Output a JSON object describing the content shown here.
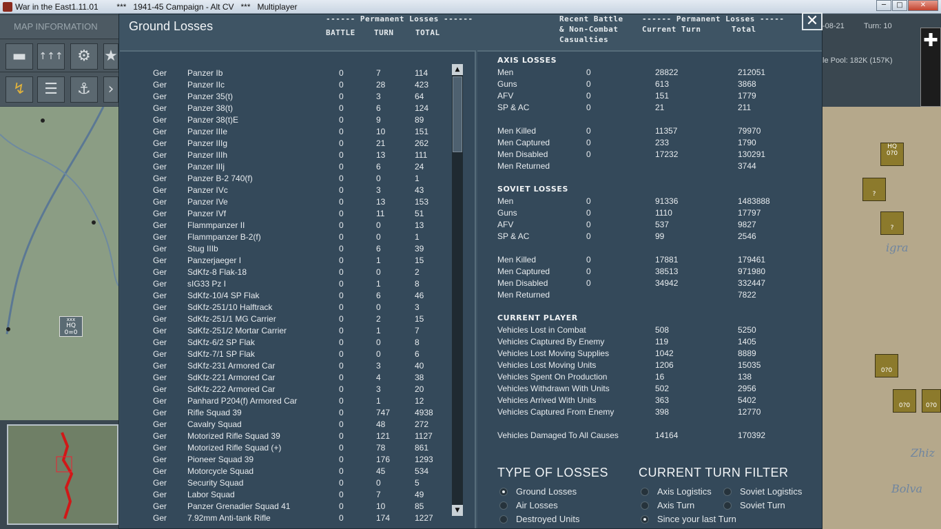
{
  "window": {
    "title": "War in the East1.11.01        ***   1941-45 Campaign - Alt CV   ***   Multiplayer",
    "minimize": "─",
    "maximize": "□",
    "close": "✕"
  },
  "sidebar": {
    "map_info_label": "MAP INFORMATION",
    "mode_keys": [
      "F1",
      "F2",
      "F3"
    ],
    "hq_label": "HQ",
    "hq_value": "0=0",
    "hq_size": "xxx"
  },
  "right_strip": {
    "date_fragment": "-08-21",
    "turn_label": "Turn: 10",
    "pool_label": "le Pool: 182K (157K)",
    "counter_label_hq": "HQ",
    "counter_value": "0?0",
    "counter_question": "?",
    "map_label_1": "igra",
    "map_label_2": "Bolva",
    "map_label_3": "Zhiz"
  },
  "dialog": {
    "title": "Ground Losses",
    "close_icon": "close-icon",
    "close_glyph": "✕",
    "left_header_group": "------ Permanent Losses ------",
    "left_col_battle": "BATTLE",
    "left_col_turn": "TURN",
    "left_col_total": "TOTAL",
    "right_header_recent_1": "Recent Battle",
    "right_header_recent_2": "& Non-Combat",
    "right_header_recent_3": "Casualties",
    "right_header_group": "------ Permanent Losses -----",
    "right_col_current": "Current Turn",
    "right_col_total": "Total"
  },
  "unit_rows": [
    {
      "nation": "Ger",
      "unit": "Panzer Ib",
      "battle": "0",
      "turn": "7",
      "total": "114"
    },
    {
      "nation": "Ger",
      "unit": "Panzer IIc",
      "battle": "0",
      "turn": "28",
      "total": "423"
    },
    {
      "nation": "Ger",
      "unit": "Panzer 35(t)",
      "battle": "0",
      "turn": "3",
      "total": "64"
    },
    {
      "nation": "Ger",
      "unit": "Panzer 38(t)",
      "battle": "0",
      "turn": "6",
      "total": "124"
    },
    {
      "nation": "Ger",
      "unit": "Panzer 38(t)E",
      "battle": "0",
      "turn": "9",
      "total": "89"
    },
    {
      "nation": "Ger",
      "unit": "Panzer IIIe",
      "battle": "0",
      "turn": "10",
      "total": "151"
    },
    {
      "nation": "Ger",
      "unit": "Panzer IIIg",
      "battle": "0",
      "turn": "21",
      "total": "262"
    },
    {
      "nation": "Ger",
      "unit": "Panzer IIIh",
      "battle": "0",
      "turn": "13",
      "total": "111"
    },
    {
      "nation": "Ger",
      "unit": "Panzer IIIj",
      "battle": "0",
      "turn": "6",
      "total": "24"
    },
    {
      "nation": "Ger",
      "unit": "Panzer B-2 740(f)",
      "battle": "0",
      "turn": "0",
      "total": "1"
    },
    {
      "nation": "Ger",
      "unit": "Panzer IVc",
      "battle": "0",
      "turn": "3",
      "total": "43"
    },
    {
      "nation": "Ger",
      "unit": "Panzer IVe",
      "battle": "0",
      "turn": "13",
      "total": "153"
    },
    {
      "nation": "Ger",
      "unit": "Panzer IVf",
      "battle": "0",
      "turn": "11",
      "total": "51"
    },
    {
      "nation": "Ger",
      "unit": "Flammpanzer II",
      "battle": "0",
      "turn": "0",
      "total": "13"
    },
    {
      "nation": "Ger",
      "unit": "Flammpanzer B-2(f)",
      "battle": "0",
      "turn": "0",
      "total": "1"
    },
    {
      "nation": "Ger",
      "unit": "Stug IIIb",
      "battle": "0",
      "turn": "6",
      "total": "39"
    },
    {
      "nation": "Ger",
      "unit": "Panzerjaeger I",
      "battle": "0",
      "turn": "1",
      "total": "15"
    },
    {
      "nation": "Ger",
      "unit": "SdKfz-8 Flak-18",
      "battle": "0",
      "turn": "0",
      "total": "2"
    },
    {
      "nation": "Ger",
      "unit": "sIG33 Pz I",
      "battle": "0",
      "turn": "1",
      "total": "8"
    },
    {
      "nation": "Ger",
      "unit": "SdKfz-10/4 SP Flak",
      "battle": "0",
      "turn": "6",
      "total": "46"
    },
    {
      "nation": "Ger",
      "unit": "SdKfz-251/10 Halftrack",
      "battle": "0",
      "turn": "0",
      "total": "3"
    },
    {
      "nation": "Ger",
      "unit": "SdKfz-251/1 MG Carrier",
      "battle": "0",
      "turn": "2",
      "total": "15"
    },
    {
      "nation": "Ger",
      "unit": "SdKfz-251/2 Mortar Carrier",
      "battle": "0",
      "turn": "1",
      "total": "7"
    },
    {
      "nation": "Ger",
      "unit": "SdKfz-6/2 SP Flak",
      "battle": "0",
      "turn": "0",
      "total": "8"
    },
    {
      "nation": "Ger",
      "unit": "SdKfz-7/1 SP Flak",
      "battle": "0",
      "turn": "0",
      "total": "6"
    },
    {
      "nation": "Ger",
      "unit": "SdKfz-231 Armored Car",
      "battle": "0",
      "turn": "3",
      "total": "40"
    },
    {
      "nation": "Ger",
      "unit": "SdKfz-221 Armored Car",
      "battle": "0",
      "turn": "4",
      "total": "38"
    },
    {
      "nation": "Ger",
      "unit": "SdKfz-222 Armored Car",
      "battle": "0",
      "turn": "3",
      "total": "20"
    },
    {
      "nation": "Ger",
      "unit": "Panhard P204(f) Armored Car",
      "battle": "0",
      "turn": "1",
      "total": "12"
    },
    {
      "nation": "Ger",
      "unit": "Rifle Squad 39",
      "battle": "0",
      "turn": "747",
      "total": "4938"
    },
    {
      "nation": "Ger",
      "unit": "Cavalry Squad",
      "battle": "0",
      "turn": "48",
      "total": "272"
    },
    {
      "nation": "Ger",
      "unit": "Motorized Rifle Squad 39",
      "battle": "0",
      "turn": "121",
      "total": "1127"
    },
    {
      "nation": "Ger",
      "unit": "Motorized Rifle Squad (+)",
      "battle": "0",
      "turn": "78",
      "total": "861"
    },
    {
      "nation": "Ger",
      "unit": "Pioneer Squad 39",
      "battle": "0",
      "turn": "176",
      "total": "1293"
    },
    {
      "nation": "Ger",
      "unit": "Motorcycle Squad",
      "battle": "0",
      "turn": "45",
      "total": "534"
    },
    {
      "nation": "Ger",
      "unit": "Security Squad",
      "battle": "0",
      "turn": "0",
      "total": "5"
    },
    {
      "nation": "Ger",
      "unit": "Labor Squad",
      "battle": "0",
      "turn": "7",
      "total": "49"
    },
    {
      "nation": "Ger",
      "unit": "Panzer Grenadier Squad 41",
      "battle": "0",
      "turn": "10",
      "total": "85"
    },
    {
      "nation": "Ger",
      "unit": "7.92mm Anti-tank Rifle",
      "battle": "0",
      "turn": "174",
      "total": "1227"
    }
  ],
  "axis": {
    "title": "AXIS LOSSES",
    "rows": [
      {
        "label": "Men",
        "recent": "0",
        "current": "28822",
        "total": "212051"
      },
      {
        "label": "Guns",
        "recent": "0",
        "current": "613",
        "total": "3868"
      },
      {
        "label": "AFV",
        "recent": "0",
        "current": "151",
        "total": "1779"
      },
      {
        "label": "SP & AC",
        "recent": "0",
        "current": "21",
        "total": "211"
      }
    ],
    "rows2": [
      {
        "label": "Men Killed",
        "recent": "0",
        "current": "11357",
        "total": "79970"
      },
      {
        "label": "Men Captured",
        "recent": "0",
        "current": "233",
        "total": "1790"
      },
      {
        "label": "Men Disabled",
        "recent": "0",
        "current": "17232",
        "total": "130291"
      },
      {
        "label": "Men Returned",
        "recent": "",
        "current": "",
        "total": "3744"
      }
    ]
  },
  "soviet": {
    "title": "SOVIET LOSSES",
    "rows": [
      {
        "label": "Men",
        "recent": "0",
        "current": "91336",
        "total": "1483888"
      },
      {
        "label": "Guns",
        "recent": "0",
        "current": "1110",
        "total": "17797"
      },
      {
        "label": "AFV",
        "recent": "0",
        "current": "537",
        "total": "9827"
      },
      {
        "label": "SP & AC",
        "recent": "0",
        "current": "99",
        "total": "2546"
      }
    ],
    "rows2": [
      {
        "label": "Men Killed",
        "recent": "0",
        "current": "17881",
        "total": "179461"
      },
      {
        "label": "Men Captured",
        "recent": "0",
        "current": "38513",
        "total": "971980"
      },
      {
        "label": "Men Disabled",
        "recent": "0",
        "current": "34942",
        "total": "332447"
      },
      {
        "label": "Men Returned",
        "recent": "",
        "current": "",
        "total": "7822"
      }
    ]
  },
  "player": {
    "title": "CURRENT PLAYER",
    "rows": [
      {
        "label": "Vehicles Lost in Combat",
        "current": "508",
        "total": "5250"
      },
      {
        "label": "Vehicles Captured By Enemy",
        "current": "119",
        "total": "1405"
      },
      {
        "label": "Vehicles Lost Moving Supplies",
        "current": "1042",
        "total": "8889"
      },
      {
        "label": "Vehicles Lost Moving Units",
        "current": "1206",
        "total": "15035"
      },
      {
        "label": "Vehicles Spent On Production",
        "current": "16",
        "total": "138"
      },
      {
        "label": "Vehicles Withdrawn With Units",
        "current": "502",
        "total": "2956"
      },
      {
        "label": "Vehicles Arrived With Units",
        "current": "363",
        "total": "5402"
      },
      {
        "label": "Vehicles Captured From Enemy",
        "current": "398",
        "total": "12770"
      }
    ],
    "damaged": {
      "label": "Vehicles Damaged To All Causes",
      "current": "14164",
      "total": "170392"
    }
  },
  "type_of_losses": {
    "title": "TYPE OF LOSSES",
    "options": [
      {
        "label": "Ground Losses",
        "selected": true
      },
      {
        "label": "Air Losses",
        "selected": false
      },
      {
        "label": "Destroyed Units",
        "selected": false
      }
    ]
  },
  "turn_filter": {
    "title": "CURRENT TURN FILTER",
    "options": [
      {
        "label": "Axis Logistics",
        "selected": false
      },
      {
        "label": "Soviet Logistics",
        "selected": false
      },
      {
        "label": "Axis Turn",
        "selected": false
      },
      {
        "label": "Soviet Turn",
        "selected": false
      },
      {
        "label": "Since your last Turn",
        "selected": true
      }
    ]
  }
}
